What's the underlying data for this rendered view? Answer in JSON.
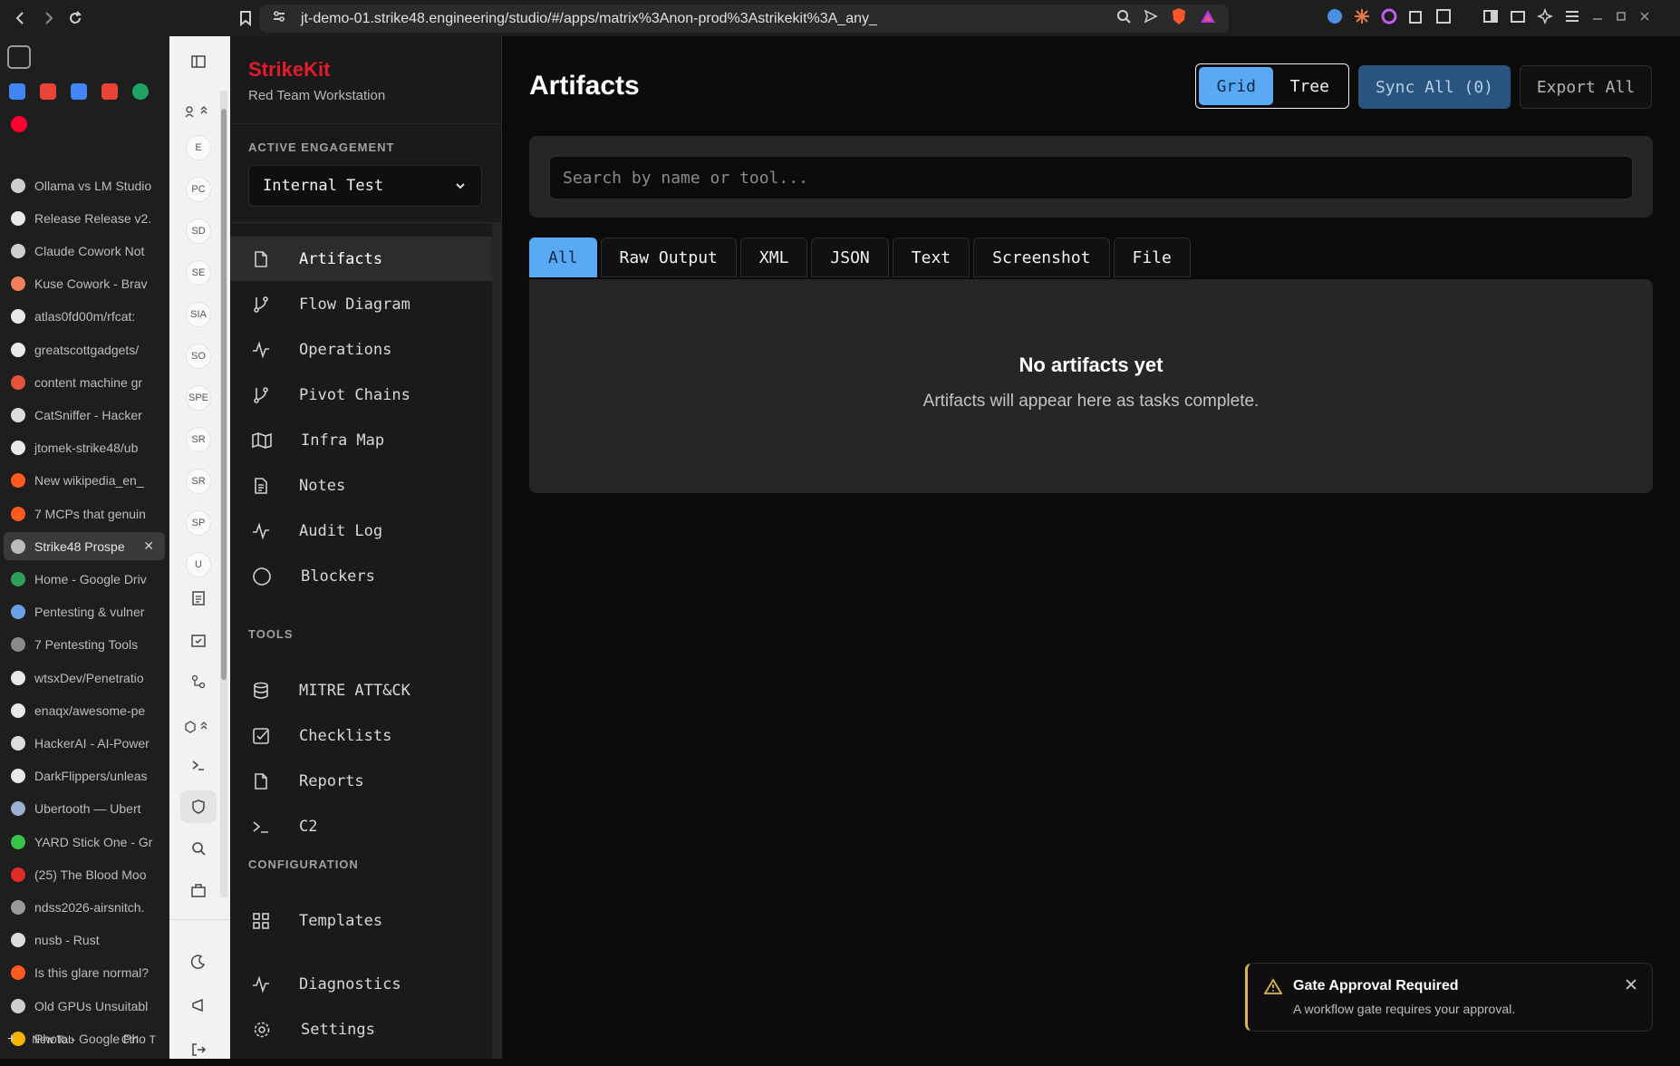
{
  "browser": {
    "url": "jt-demo-01.strike48.engineering/studio/#/apps/matrix%3Anon-prod%3Astrikekit%3A_any_"
  },
  "tabs": [
    {
      "label": "Ollama vs LM Studio",
      "color": "#cfcfcf"
    },
    {
      "label": "Release Release v2.",
      "color": "#e8e8e8"
    },
    {
      "label": "Claude Cowork Not",
      "color": "#cfcfcf"
    },
    {
      "label": "Kuse Cowork - Brav",
      "color": "#f07f5a"
    },
    {
      "label": "atlas0fd00m/rfcat:",
      "color": "#e8e8e8"
    },
    {
      "label": "greatscottgadgets/",
      "color": "#e8e8e8"
    },
    {
      "label": "content machine gr",
      "color": "#e5533d"
    },
    {
      "label": "CatSniffer - Hacker",
      "color": "#dddddd"
    },
    {
      "label": "jtomek-strike48/ub",
      "color": "#e8e8e8"
    },
    {
      "label": "New wikipedia_en_",
      "color": "#ff5a1f"
    },
    {
      "label": "7 MCPs that genuin",
      "color": "#ff5a1f"
    },
    {
      "label": "Strike48 Prospe",
      "color": "#bbbbbb",
      "active": true
    },
    {
      "label": "Home - Google Driv",
      "color": "#2f9e5a"
    },
    {
      "label": "Pentesting & vulner",
      "color": "#6aa1e6"
    },
    {
      "label": "7 Pentesting Tools",
      "color": "#8a8a8a"
    },
    {
      "label": "wtsxDev/Penetratio",
      "color": "#e8e8e8"
    },
    {
      "label": "enaqx/awesome-pe",
      "color": "#e8e8e8"
    },
    {
      "label": "HackerAI - AI-Power",
      "color": "#dddddd"
    },
    {
      "label": "DarkFlippers/unleas",
      "color": "#e8e8e8"
    },
    {
      "label": "Ubertooth — Ubert",
      "color": "#9aaed6"
    },
    {
      "label": "YARD Stick One - Gr",
      "color": "#37c24a"
    },
    {
      "label": "(25) The Blood Moo",
      "color": "#e22b2b"
    },
    {
      "label": "ndss2026-airsnitch.",
      "color": "#999999"
    },
    {
      "label": "nusb - Rust",
      "color": "#dddddd"
    },
    {
      "label": "Is this glare normal?",
      "color": "#ff5a1f"
    },
    {
      "label": "Old GPUs Unsuitabl",
      "color": "#cfcfcf"
    },
    {
      "label": "Photo - Google Pho",
      "color": "#f4b400"
    }
  ],
  "new_tab": {
    "label": "New Tab",
    "shortcut_key1": "Ctrl",
    "shortcut_key2": "T"
  },
  "rail": {
    "items": [
      "E",
      "PC",
      "SD",
      "SE",
      "SIA",
      "SO",
      "SPE",
      "SR",
      "SR",
      "SP",
      "U"
    ]
  },
  "sidebar": {
    "brand": "StrikeKit",
    "subtitle": "Red Team Workstation",
    "engagement_label": "ACTIVE ENGAGEMENT",
    "engagement_value": "Internal Test",
    "nav": [
      {
        "label": "Artifacts",
        "icon": "file-icon",
        "active": true
      },
      {
        "label": "Flow Diagram",
        "icon": "git-branch-icon"
      },
      {
        "label": "Operations",
        "icon": "activity-icon"
      },
      {
        "label": "Pivot Chains",
        "icon": "git-branch-icon"
      },
      {
        "label": "Infra Map",
        "icon": "map-icon"
      },
      {
        "label": "Notes",
        "icon": "file-text-icon"
      },
      {
        "label": "Audit Log",
        "icon": "activity-icon"
      },
      {
        "label": "Blockers",
        "icon": "circle-icon"
      }
    ],
    "tools_label": "TOOLS",
    "tools": [
      {
        "label": "MITRE ATT&CK",
        "icon": "database-icon"
      },
      {
        "label": "Checklists",
        "icon": "check-square-icon"
      },
      {
        "label": "Reports",
        "icon": "file-icon"
      },
      {
        "label": "C2",
        "icon": "terminal-icon"
      }
    ],
    "config_label": "CONFIGURATION",
    "config": [
      {
        "label": "Templates",
        "icon": "grid-icon"
      }
    ],
    "bottom": [
      {
        "label": "Diagnostics",
        "icon": "activity-icon"
      },
      {
        "label": "Settings",
        "icon": "gear-icon"
      }
    ]
  },
  "main": {
    "title": "Artifacts",
    "view_grid": "Grid",
    "view_tree": "Tree",
    "sync_label": "Sync All (0)",
    "export_label": "Export All",
    "search_placeholder": "Search by name or tool...",
    "filters": [
      "All",
      "Raw Output",
      "XML",
      "JSON",
      "Text",
      "Screenshot",
      "File"
    ],
    "empty_title": "No artifacts yet",
    "empty_message": "Artifacts will appear here as tasks complete."
  },
  "toast": {
    "title": "Gate Approval Required",
    "message": "A workflow gate requires your approval."
  },
  "colors": {
    "brand": "#e21c2c",
    "accent": "#5aa9f5",
    "warning": "#e0b550"
  }
}
